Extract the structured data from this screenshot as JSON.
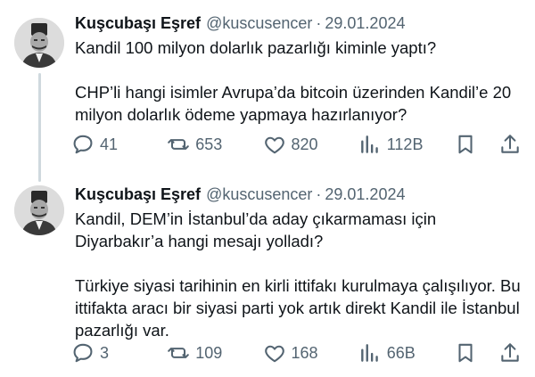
{
  "colors": {
    "text": "#0f1419",
    "secondary": "#536471",
    "thread_line": "#cfd9de"
  },
  "tweets": [
    {
      "name": "Kuşcubaşı Eşref",
      "handle": "@kuscusencer",
      "separator": "·",
      "date": "29.01.2024",
      "text": "Kandil 100 milyon dolarlık pazarlığı kiminle yaptı?\n\nCHP’li hangi isimler Avrupa’da bitcoin üzerinden Kandil’e 20 milyon dolarlık ödeme yapmaya hazırlanıyor?",
      "replies": "41",
      "reposts": "653",
      "likes": "820",
      "views": "112B"
    },
    {
      "name": "Kuşcubaşı Eşref",
      "handle": "@kuscusencer",
      "separator": "·",
      "date": "29.01.2024",
      "text": "Kandil, DEM’in İstanbul’da aday çıkarmaması için Diyarbakır’a hangi mesajı yolladı?\n\nTürkiye siyasi tarihinin en kirli ittifakı kurulmaya çalışılıyor. Bu ittifakta aracı bir siyasi parti yok artık direkt Kandil ile İstanbul pazarlığı var.",
      "replies": "3",
      "reposts": "109",
      "likes": "168",
      "views": "66B"
    }
  ],
  "icons": [
    "reply-icon",
    "repost-icon",
    "like-icon",
    "views-icon",
    "bookmark-icon",
    "share-icon"
  ]
}
